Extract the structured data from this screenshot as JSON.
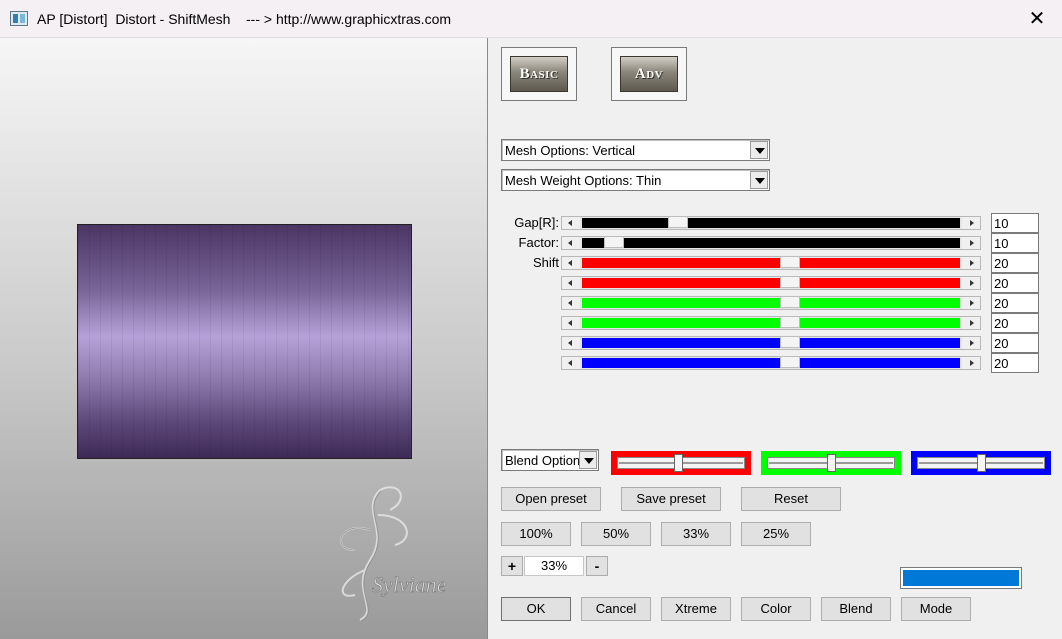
{
  "window": {
    "title": "AP [Distort]  Distort - ShiftMesh    --- > http://www.graphicxtras.com",
    "close_glyph": "✕"
  },
  "watermark": {
    "signature": "Sylviane"
  },
  "mode_buttons": {
    "basic": "Basic",
    "adv": "Adv"
  },
  "mesh_options": {
    "selected": "Mesh Options: Vertical"
  },
  "mesh_weight": {
    "selected": "Mesh Weight Options: Thin"
  },
  "sliders": [
    {
      "label": "Gap[R]:",
      "value": "10",
      "fraction": 0.24,
      "color": "#000000"
    },
    {
      "label": "Factor:",
      "value": "10",
      "fraction": 0.06,
      "color": "#000000"
    },
    {
      "label": "Shift",
      "value": "20",
      "fraction": 0.55,
      "color": "#ff0000"
    },
    {
      "label": "",
      "value": "20",
      "fraction": 0.55,
      "color": "#ff0000"
    },
    {
      "label": "",
      "value": "20",
      "fraction": 0.55,
      "color": "#00ff00"
    },
    {
      "label": "",
      "value": "20",
      "fraction": 0.55,
      "color": "#00ff00"
    },
    {
      "label": "",
      "value": "20",
      "fraction": 0.55,
      "color": "#0000ff"
    },
    {
      "label": "",
      "value": "20",
      "fraction": 0.55,
      "color": "#0000ff"
    }
  ],
  "blend": {
    "selected": "Blend Options",
    "channels": [
      {
        "color": "#ff0000",
        "fraction": 0.48
      },
      {
        "color": "#00ff00",
        "fraction": 0.5
      },
      {
        "color": "#0000ff",
        "fraction": 0.5
      }
    ]
  },
  "preset_buttons": {
    "open": "Open preset",
    "save": "Save preset",
    "reset": "Reset"
  },
  "zoom_buttons": [
    "100%",
    "50%",
    "33%",
    "25%"
  ],
  "zoom": {
    "minus": "-",
    "plus": "+",
    "value": "33%"
  },
  "accent_color": "#0078d7",
  "bottom_buttons": [
    "OK",
    "Cancel",
    "Xtreme",
    "Color",
    "Blend",
    "Mode"
  ]
}
